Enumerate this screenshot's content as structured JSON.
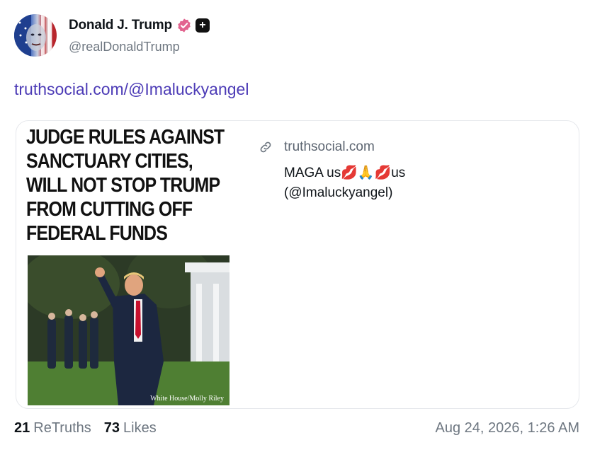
{
  "author": {
    "display_name": "Donald J. Trump",
    "handle": "@realDonaldTrump",
    "verified_color": "#e2648f"
  },
  "post": {
    "link_text": "truthsocial.com/@Imaluckyangel"
  },
  "link_card": {
    "source": "truthsocial.com",
    "title": "MAGA us💋🙏💋us",
    "subtitle": "(@Imaluckyangel)",
    "thumbnail": {
      "headline_lines": [
        "JUDGE RULES AGAINST",
        "SANCTUARY CITIES,",
        "WILL NOT STOP TRUMP",
        "FROM CUTTING OFF",
        "FEDERAL FUNDS"
      ],
      "photo_credit": "White House/Molly Riley"
    }
  },
  "stats": {
    "retruths_count": "21",
    "retruths_label": "ReTruths",
    "likes_count": "73",
    "likes_label": "Likes",
    "timestamp": "Aug 24, 2026, 1:26 AM"
  },
  "colors": {
    "link": "#4c3bb6",
    "muted": "#6e7781"
  }
}
